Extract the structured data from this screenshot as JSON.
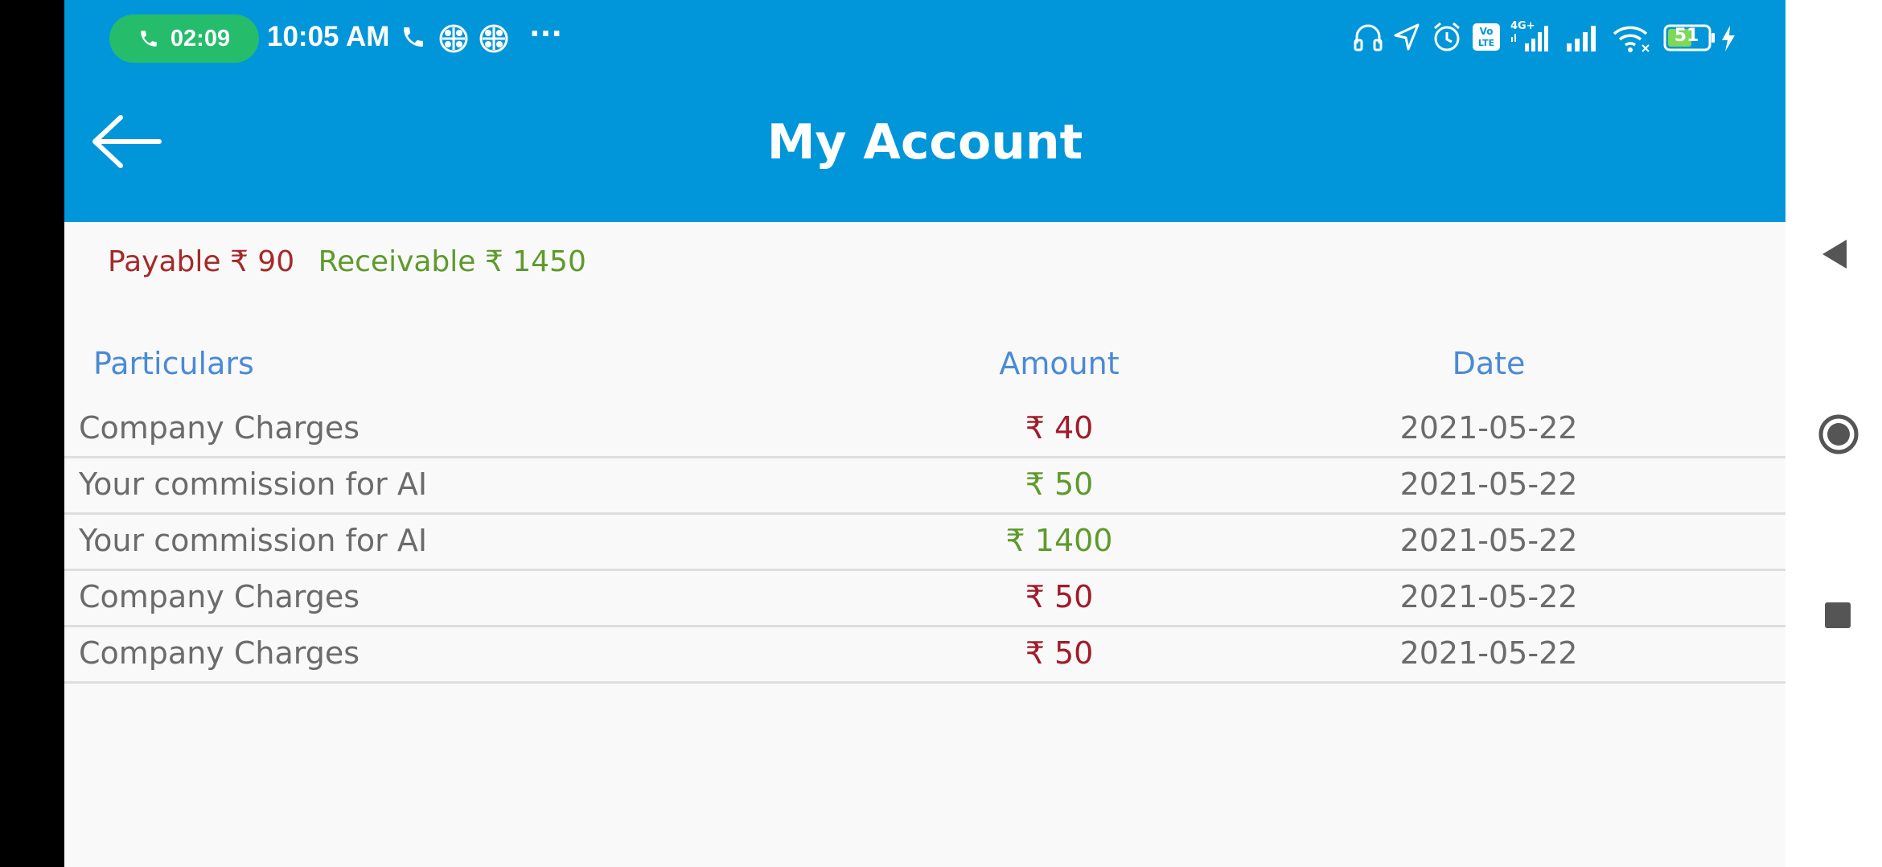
{
  "status_bar": {
    "call_timer": "02:09",
    "time": "10:05 AM",
    "more": "···",
    "battery": "51"
  },
  "header": {
    "title": "My Account"
  },
  "summary": {
    "payable_label": "Payable ₹ 90",
    "receivable_label": "Receivable ₹ 1450"
  },
  "table": {
    "columns": [
      "Particulars",
      "Amount",
      "Date"
    ],
    "rows": [
      {
        "particulars": "Company Charges",
        "amount": "₹ 40",
        "date": "2021-05-22",
        "type": "debit"
      },
      {
        "particulars": "Your commission for AI",
        "amount": "₹ 50",
        "date": "2021-05-22",
        "type": "credit"
      },
      {
        "particulars": "Your commission for AI",
        "amount": "₹ 1400",
        "date": "2021-05-22",
        "type": "credit"
      },
      {
        "particulars": "Company Charges",
        "amount": "₹ 50",
        "date": "2021-05-22",
        "type": "debit"
      },
      {
        "particulars": "Company Charges",
        "amount": "₹ 50",
        "date": "2021-05-22",
        "type": "debit"
      }
    ]
  },
  "colors": {
    "header_bg": "#0096d9",
    "column_header": "#4a8ad6",
    "debit": "#a01c2a",
    "credit": "#5e9a2c",
    "call_pill": "#25bc6c"
  }
}
